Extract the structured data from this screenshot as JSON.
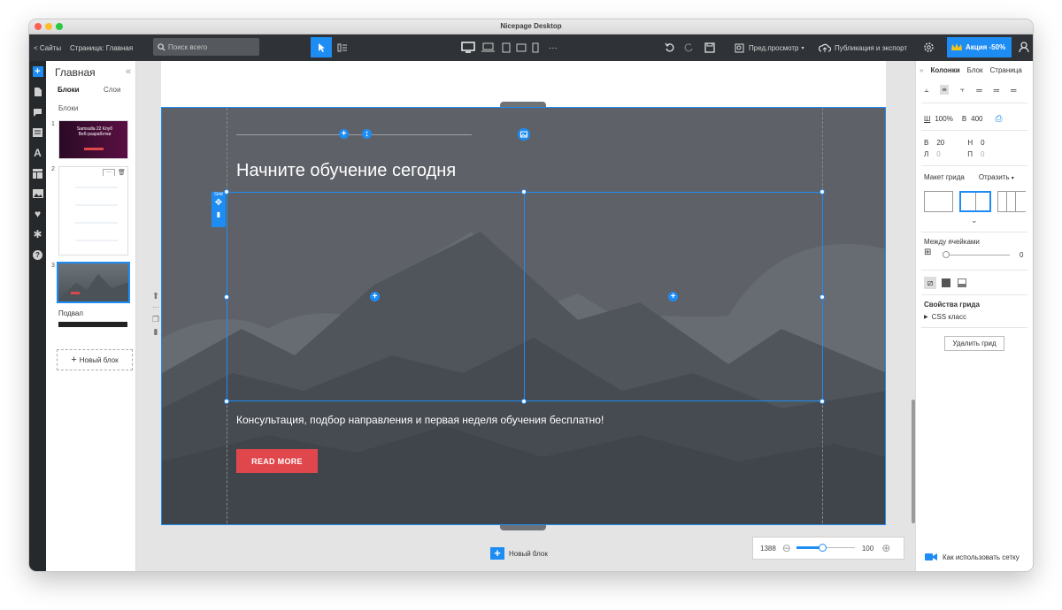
{
  "window": {
    "title": "Nicepage Desktop"
  },
  "toolbar": {
    "back_sites": "< Сайты",
    "page_label": "Страница: Главная",
    "search_placeholder": "Поиск всего",
    "more_label": "···",
    "preview_label": "Пред.просмотр",
    "publish_label": "Публикация и экспорт",
    "promo_label": "Акция -50%"
  },
  "pages_panel": {
    "title": "Главная",
    "tab_blocks": "Блоки",
    "tab_layers": "Слои",
    "section_label": "Блоки",
    "thumbs": [
      {
        "number": "1",
        "text": "Samsulla 22 Клуб Веб-разработки"
      },
      {
        "number": "2"
      },
      {
        "number": "3"
      }
    ],
    "footer_label": "Подвал",
    "new_block": "Новый блок"
  },
  "canvas": {
    "hero_title": "Начните обучение сегодня",
    "hero_text": "Консультация, подбор направления и первая неделя обучения бесплатно!",
    "button_label": "READ MORE",
    "grid_tag": "Grid",
    "new_block": "Новый блок",
    "zoom": {
      "width_value": "1388",
      "zoom_value": "100",
      "zoom_fraction": 0.45
    }
  },
  "properties": {
    "tabs": [
      "Колонки",
      "Блок",
      "Страница"
    ],
    "active_tab": "Колонки",
    "width_label": "Ш",
    "width_value": "100%",
    "height_label": "В",
    "height_value": "400",
    "top_label": "В",
    "top_value": "20",
    "bottom_label": "Н",
    "bottom_value": "0",
    "left_label": "Л",
    "left_value": "0",
    "right_label": "П",
    "right_value": "0",
    "grid_layout_label": "Макет грида",
    "mirror_label": "Отразить",
    "cell_spacing_label": "Между ячейками",
    "cell_spacing_value": "0",
    "grid_props_label": "Свойства грида",
    "css_class_label": "CSS класс",
    "delete_grid": "Удалить грид",
    "help_label": "Как использовать сетку"
  },
  "colors": {
    "accent": "#1d8cf3",
    "hero_bg": "#5e6268",
    "button": "#e0474c",
    "toolbar": "#2f3236"
  },
  "icons": {
    "left_bar": [
      "add-icon",
      "pages-icon",
      "chat-icon",
      "text-block-icon",
      "font-icon",
      "layout-icon",
      "image-icon",
      "heart-icon",
      "gear-icon",
      "help-icon"
    ]
  }
}
